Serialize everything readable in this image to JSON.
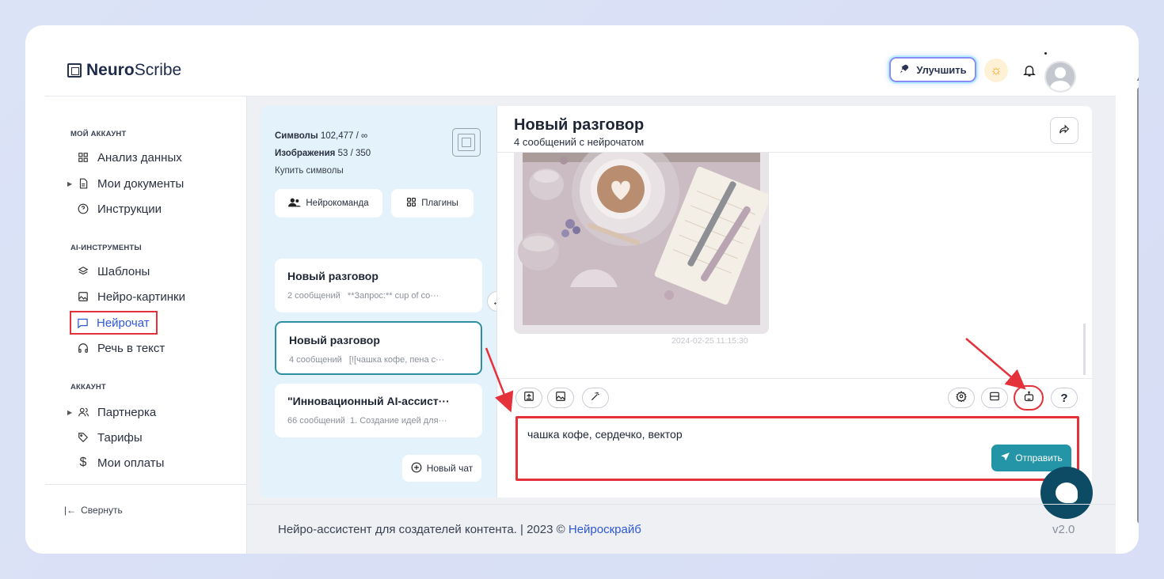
{
  "header": {
    "logo_bold": "Neuro",
    "logo_rest": "Scribe",
    "upgrade_label": "Улучшить"
  },
  "sidebar": {
    "sections": [
      {
        "title": "МОЙ АККАУНТ"
      },
      {
        "title": "AI-ИНСТРУМЕНТЫ"
      },
      {
        "title": "АККАУНТ"
      }
    ],
    "items": [
      {
        "label": "Анализ данных",
        "icon": "grid-icon"
      },
      {
        "label": "Мои документы",
        "icon": "document-icon"
      },
      {
        "label": "Инструкции",
        "icon": "help-circle-icon"
      },
      {
        "label": "Шаблоны",
        "icon": "layers-icon"
      },
      {
        "label": "Нейро-картинки",
        "icon": "image-icon"
      },
      {
        "label": "Нейрочат",
        "icon": "chat-icon"
      },
      {
        "label": "Речь в текст",
        "icon": "headphones-icon"
      },
      {
        "label": "Партнерка",
        "icon": "users-icon"
      },
      {
        "label": "Тарифы",
        "icon": "tag-icon"
      },
      {
        "label": "Мои оплаты",
        "icon": "dollar-icon"
      }
    ],
    "collapse_label": "Свернуть"
  },
  "panel": {
    "symbols_label": "Символы",
    "symbols_value": "102,477 / ∞",
    "images_label": "Изображения",
    "images_value": "53 / 350",
    "buy_label": "Купить символы",
    "team_label": "Нейрокоманда",
    "plugins_label": "Плагины",
    "new_chat_label": "Новый чат",
    "conversations": [
      {
        "title": "Новый разговор",
        "count": "2 сообщений",
        "preview": "**Запрос:** cup of co···"
      },
      {
        "title": "Новый разговор",
        "count": "4 сообщений",
        "preview": "[![чашка кофе, пена с···"
      },
      {
        "title": "\"Инновационный AI-ассист···",
        "count": "66 сообщений",
        "preview": "1. Создание идей для···"
      }
    ]
  },
  "chat": {
    "title": "Новый разговор",
    "subtitle": "4 сообщений с нейрочатом",
    "timestamp": "2024-02-25 11:15:30",
    "input_value": "чашка кофе, сердечко, вектор",
    "send_label": "Отправить",
    "help_label": "?"
  },
  "footer": {
    "text": "Нейро-ассистент для создателей контента.  | 2023 ©",
    "link": "Нейроскрайб",
    "version": "v2.0"
  },
  "colors": {
    "accent": "#2495a6",
    "highlight_red": "#e5313a",
    "link_blue": "#2f57d6",
    "panel_bg": "#e3f2fb"
  }
}
